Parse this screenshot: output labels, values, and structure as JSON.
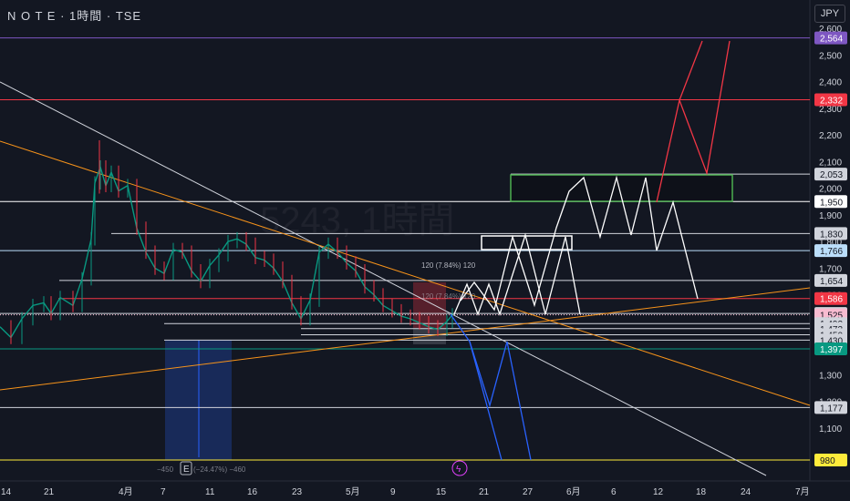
{
  "header": {
    "title": "N O T E · 1時間 · TSE",
    "currency": "JPY"
  },
  "watermark": "5243, 1時間",
  "chart_data": {
    "type": "line",
    "ylim": [
      900,
      2630
    ],
    "y_ticks": [
      1100,
      1200,
      1300,
      1400,
      1500,
      1600,
      1700,
      1800,
      1900,
      2000,
      2100,
      2200,
      2300,
      2400,
      2500,
      2600
    ],
    "y_tick_labels": [
      "1,100",
      "1,200",
      "1,300",
      "1,400",
      "1,500",
      "1,600",
      "1,700",
      "1,800",
      "1,900",
      "2,000",
      "2,100",
      "2,200",
      "2,300",
      "2,400",
      "2,500",
      "2,600"
    ],
    "x_labels": [
      "14",
      "21",
      "4月",
      "7",
      "11",
      "16",
      "23",
      "5月",
      "9",
      "15",
      "21",
      "27",
      "6月",
      "6",
      "12",
      "18",
      "24",
      "7月"
    ],
    "price_levels": [
      {
        "value": 2564,
        "label": "2,564",
        "color": "#7e57c2",
        "text_color": "#ffffff"
      },
      {
        "value": 2332,
        "label": "2,332",
        "color": "#f23645",
        "text_color": "#ffffff"
      },
      {
        "value": 2053,
        "label": "2,053",
        "color": "#d1d4dc",
        "text_color": "#131722"
      },
      {
        "value": 1950,
        "label": "1,950",
        "color": "#ffffff",
        "text_color": "#131722"
      },
      {
        "value": 1830,
        "label": "1,830",
        "color": "#d1d4dc",
        "text_color": "#131722"
      },
      {
        "value": 1766,
        "label": "1,766",
        "color": "#bbdefb",
        "text_color": "#131722"
      },
      {
        "value": 1654,
        "label": "1,654",
        "color": "#d1d4dc",
        "text_color": "#131722"
      },
      {
        "value": 1586,
        "label": "1,586",
        "color": "#f23645",
        "text_color": "#ffffff"
      },
      {
        "value": 1530,
        "label": "1,530",
        "color": "#d1d4dc",
        "text_color": "#131722"
      },
      {
        "value": 1525,
        "label": "1,525",
        "color": "#f8bbd0",
        "text_color": "#131722"
      },
      {
        "value": 1492,
        "label": "1,492",
        "color": "#d1d4dc",
        "text_color": "#131722"
      },
      {
        "value": 1473,
        "label": "1,473",
        "color": "#d1d4dc",
        "text_color": "#131722"
      },
      {
        "value": 1450,
        "label": "1,450",
        "color": "#d1d4dc",
        "text_color": "#131722"
      },
      {
        "value": 1430,
        "label": "1,430",
        "color": "#d1d4dc",
        "text_color": "#131722"
      },
      {
        "value": 1397,
        "label": "1,397",
        "color": "#089981",
        "text_color": "#ffffff"
      },
      {
        "value": 1177,
        "label": "1,177",
        "color": "#d1d4dc",
        "text_color": "#131722"
      },
      {
        "value": 980,
        "label": "980",
        "color": "#ffeb3b",
        "text_color": "#131722"
      }
    ],
    "price_series": [
      [
        0,
        1480
      ],
      [
        12,
        1440
      ],
      [
        24,
        1510
      ],
      [
        36,
        1560
      ],
      [
        48,
        1570
      ],
      [
        56,
        1530
      ],
      [
        66,
        1590
      ],
      [
        80,
        1560
      ],
      [
        90,
        1660
      ],
      [
        100,
        1810
      ],
      [
        104,
        2020
      ],
      [
        110,
        2080
      ],
      [
        116,
        2010
      ],
      [
        122,
        2060
      ],
      [
        130,
        1990
      ],
      [
        140,
        2010
      ],
      [
        150,
        1850
      ],
      [
        160,
        1760
      ],
      [
        170,
        1700
      ],
      [
        180,
        1680
      ],
      [
        190,
        1770
      ],
      [
        200,
        1760
      ],
      [
        210,
        1690
      ],
      [
        220,
        1650
      ],
      [
        230,
        1710
      ],
      [
        240,
        1750
      ],
      [
        250,
        1800
      ],
      [
        260,
        1810
      ],
      [
        270,
        1790
      ],
      [
        280,
        1740
      ],
      [
        290,
        1730
      ],
      [
        300,
        1700
      ],
      [
        310,
        1650
      ],
      [
        320,
        1570
      ],
      [
        330,
        1510
      ],
      [
        340,
        1580
      ],
      [
        350,
        1760
      ],
      [
        360,
        1790
      ],
      [
        370,
        1760
      ],
      [
        380,
        1720
      ],
      [
        390,
        1690
      ],
      [
        400,
        1630
      ],
      [
        410,
        1600
      ],
      [
        420,
        1560
      ],
      [
        430,
        1540
      ],
      [
        440,
        1520
      ],
      [
        450,
        1510
      ],
      [
        460,
        1495
      ],
      [
        470,
        1480
      ],
      [
        480,
        1470
      ],
      [
        490,
        1500
      ],
      [
        496,
        1525
      ]
    ],
    "annotations": {
      "pct_label": "120 (7.84%) 120",
      "pct_label_faded": "120 (7.84%) 120",
      "drop_label_left": "−450",
      "drop_label_pct": "(−24.47%) −460",
      "earnings_badge": "E",
      "flash_badge": "ϟ"
    }
  }
}
